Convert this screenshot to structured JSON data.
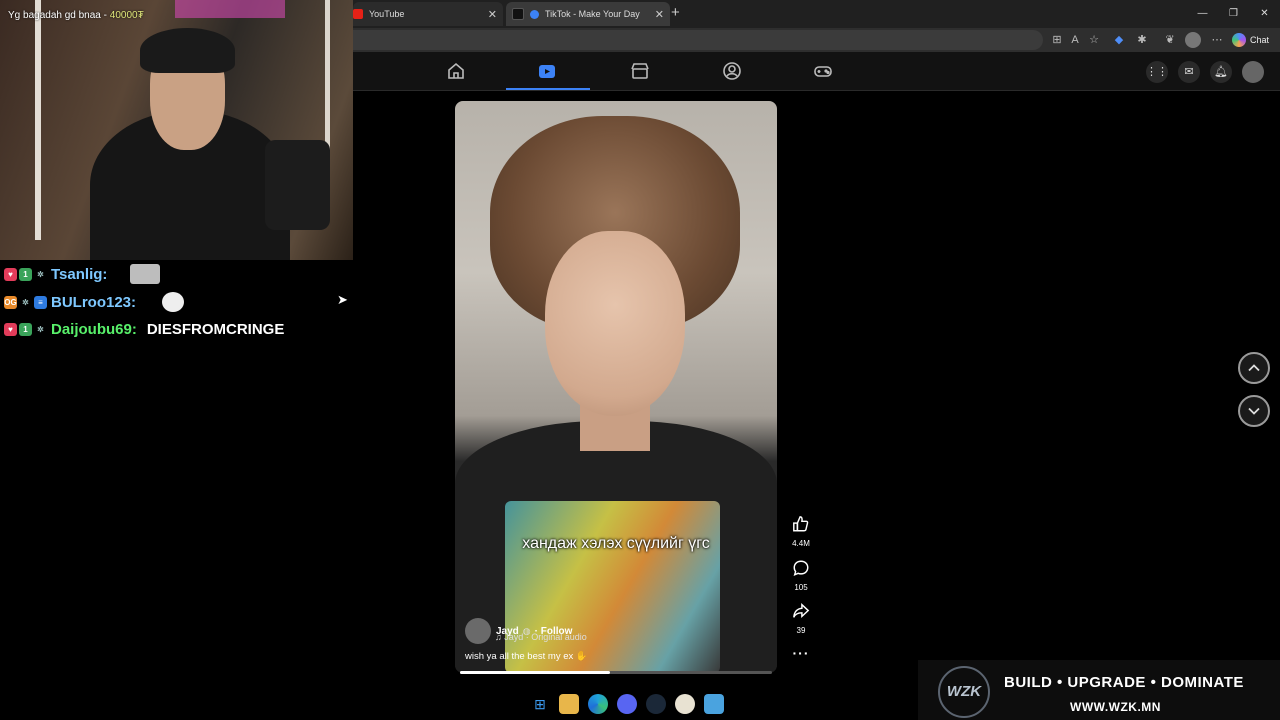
{
  "overlay": {
    "donation_text": "Yg bagadah gd bnaa -",
    "donation_amount": "40000₮"
  },
  "browser": {
    "tabs": [
      {
        "label": "YouTube"
      },
      {
        "label": "TikTok - Make Your Day"
      }
    ],
    "new_tab": "+",
    "chat_label": "Chat"
  },
  "chat": [
    {
      "user": "Tsanlig:",
      "message": "",
      "user_color": "#7ec8ff"
    },
    {
      "user": "BULroo123:",
      "message": "",
      "user_color": "#7ec8ff"
    },
    {
      "user": "Daijoubu69:",
      "message": "DIESFROMCRINGE",
      "user_color": "#58f06a"
    }
  ],
  "video": {
    "caption": "хандаж хэлэх сүүлийг үгс",
    "author": "Jayd",
    "follow": "· Follow",
    "audio": "Jayd · Original audio",
    "description": "wish ya all the best my ex",
    "progress": 0.48
  },
  "actions": {
    "likes": "4.4M",
    "comments": "105",
    "shares": "39"
  },
  "banner": {
    "logo": "WZK",
    "slogan": "BUILD • UPGRADE • DOMINATE",
    "url": "WWW.WZK.MN"
  }
}
